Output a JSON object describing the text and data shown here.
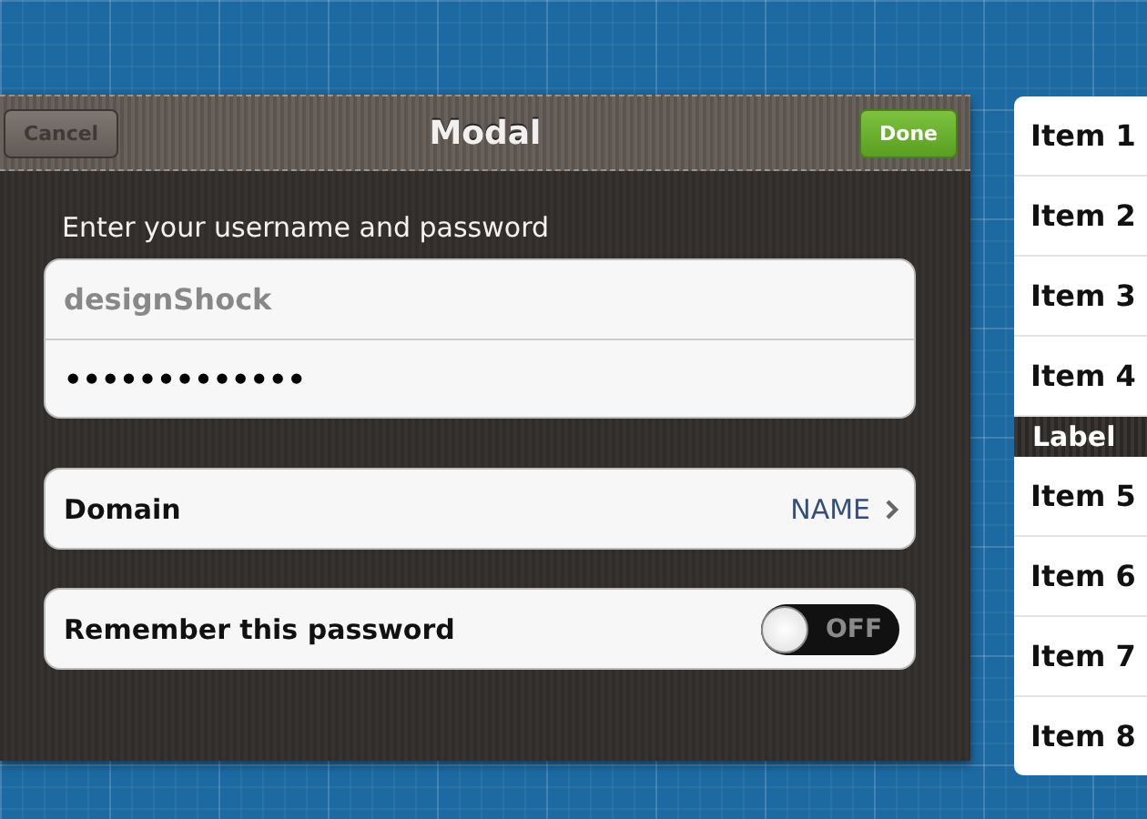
{
  "modal": {
    "title": "Modal",
    "cancel_button": "Cancel",
    "done_button": "Done",
    "prompt": "Enter your username and password",
    "username": {
      "placeholder": "designShock"
    },
    "password": {
      "value": "•••••••••••••"
    },
    "domain": {
      "label": "Domain",
      "value": "NAME"
    },
    "remember": {
      "label": "Remember this password",
      "on": false,
      "switch_text": "OFF"
    }
  },
  "list": [
    {
      "kind": "item",
      "text": "Item 1"
    },
    {
      "kind": "item",
      "text": "Item 2"
    },
    {
      "kind": "item",
      "text": "Item 3"
    },
    {
      "kind": "item",
      "text": "Item 4"
    },
    {
      "kind": "header",
      "text": "Label"
    },
    {
      "kind": "item",
      "text": "Item 5"
    },
    {
      "kind": "item",
      "text": "Item 6"
    },
    {
      "kind": "item",
      "text": "Item 7"
    },
    {
      "kind": "item",
      "text": "Item 8"
    }
  ]
}
